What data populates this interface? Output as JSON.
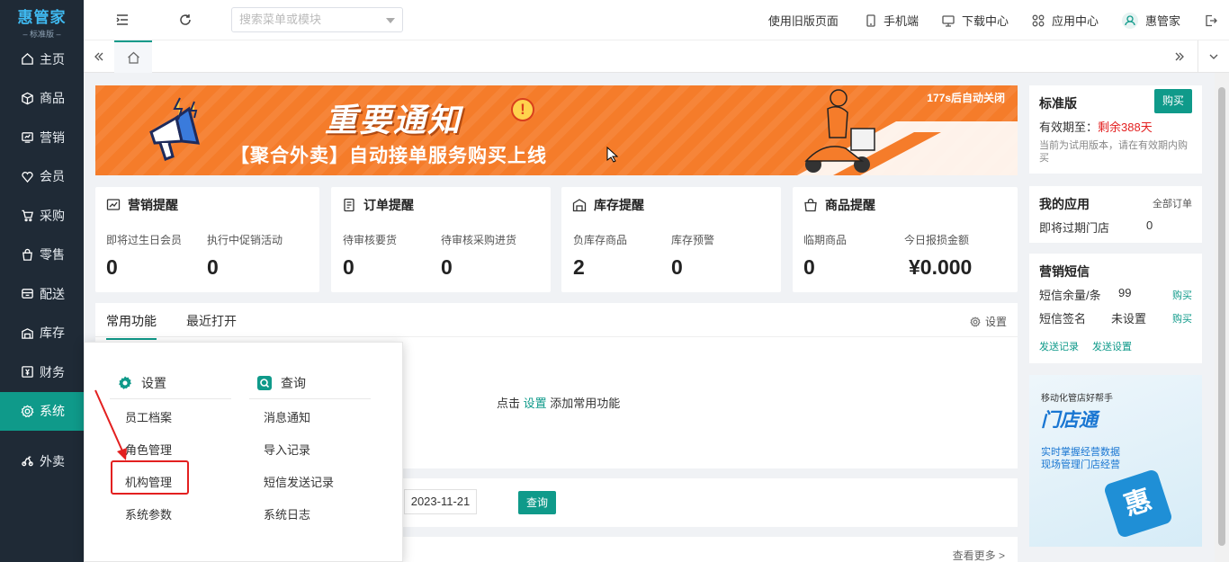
{
  "app": {
    "logo_main": "惠管家",
    "logo_sub": "标准版"
  },
  "nav": [
    {
      "label": "主页",
      "icon": "home-icon"
    },
    {
      "label": "商品",
      "icon": "box-icon"
    },
    {
      "label": "营销",
      "icon": "marketing-icon"
    },
    {
      "label": "会员",
      "icon": "member-icon"
    },
    {
      "label": "采购",
      "icon": "cart-icon"
    },
    {
      "label": "零售",
      "icon": "bag-icon"
    },
    {
      "label": "配送",
      "icon": "truck-icon"
    },
    {
      "label": "库存",
      "icon": "warehouse-icon"
    },
    {
      "label": "财务",
      "icon": "finance-icon"
    },
    {
      "label": "系统",
      "icon": "gear-icon",
      "active": true
    },
    {
      "label": "外卖",
      "icon": "scooter-icon"
    }
  ],
  "topbar": {
    "search_placeholder": "搜索菜单或模块",
    "old_version": "使用旧版页面",
    "mobile": "手机端",
    "download": "下载中心",
    "apps": "应用中心",
    "user": "惠管家"
  },
  "banner": {
    "title": "重要通知",
    "subtitle": "【聚合外卖】自动接单服务购买上线",
    "countdown": "177s后自动关闭"
  },
  "reminders": [
    {
      "title": "营销提醒",
      "items": [
        {
          "label": "即将过生日会员",
          "value": "0"
        },
        {
          "label": "执行中促销活动",
          "value": "0"
        }
      ]
    },
    {
      "title": "订单提醒",
      "items": [
        {
          "label": "待审核要货",
          "value": "0"
        },
        {
          "label": "待审核采购进货",
          "value": "0"
        }
      ]
    },
    {
      "title": "库存提醒",
      "items": [
        {
          "label": "负库存商品",
          "value": "2"
        },
        {
          "label": "库存预警",
          "value": "0"
        }
      ]
    },
    {
      "title": "商品提醒",
      "items": [
        {
          "label": "临期商品",
          "value": "0"
        },
        {
          "label": "今日报损金额",
          "value": "¥0.000"
        }
      ]
    }
  ],
  "common": {
    "tab_common": "常用功能",
    "tab_recent": "最近打开",
    "setting": "设置",
    "empty_prefix": "点击",
    "empty_link": "设置",
    "empty_suffix": "添加常用功能"
  },
  "filter": {
    "date": "2023-11-21",
    "query": "查询"
  },
  "bottom": {
    "more": "查看更多 >"
  },
  "edition": {
    "title": "标准版",
    "buy": "购买",
    "expiry_label": "有效期至：",
    "expiry_value": "剩余388天",
    "note": "当前为试用版本，请在有效期内购买"
  },
  "my_apps": {
    "title": "我的应用",
    "all": "全部订单",
    "row_label": "即将过期门店",
    "row_value": "0"
  },
  "sms": {
    "title": "营销短信",
    "r1_label": "短信余量/条",
    "r1_value": "99",
    "r1_action": "购买",
    "r2_label": "短信签名",
    "r2_value": "未设置",
    "r2_action": "购买",
    "link1": "发送记录",
    "link2": "发送设置"
  },
  "promo": {
    "top": "移动化管店好帮手",
    "title": "门店通",
    "line1": "实时掌握经营数据",
    "line2": "现场管理门店经营",
    "badge": "惠"
  },
  "dropdown": {
    "col1_title": "设置",
    "col1": [
      "员工档案",
      "角色管理",
      "机构管理",
      "系统参数"
    ],
    "col2_title": "查询",
    "col2": [
      "消息通知",
      "导入记录",
      "短信发送记录",
      "系统日志"
    ]
  },
  "colors": {
    "accent": "#0f9a8a",
    "sidebar": "#1f2a36",
    "banner": "#f57c2a",
    "alert": "#e32020"
  }
}
